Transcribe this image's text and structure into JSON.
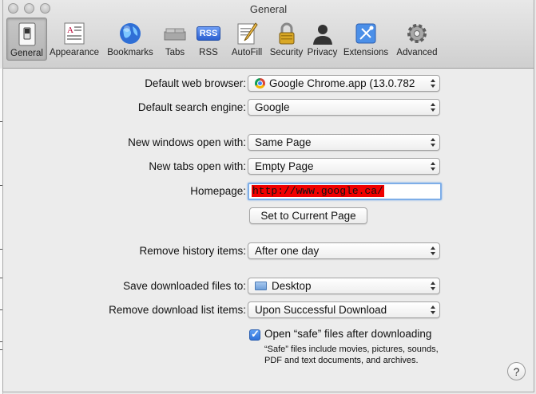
{
  "window": {
    "title": "General"
  },
  "toolbar": {
    "tabs": [
      {
        "label": "General",
        "icon": "switch-icon"
      },
      {
        "label": "Appearance",
        "icon": "appearance-icon"
      },
      {
        "label": "Bookmarks",
        "icon": "globe-icon"
      },
      {
        "label": "Tabs",
        "icon": "tabs-icon"
      },
      {
        "label": "RSS",
        "icon": "rss-icon"
      },
      {
        "label": "AutoFill",
        "icon": "autofill-icon"
      },
      {
        "label": "Security",
        "icon": "lock-icon"
      },
      {
        "label": "Privacy",
        "icon": "person-icon"
      },
      {
        "label": "Extensions",
        "icon": "extensions-icon"
      },
      {
        "label": "Advanced",
        "icon": "gear-icon"
      }
    ],
    "selected": "General",
    "rss_badge": "RSS"
  },
  "settings": {
    "default_browser": {
      "label": "Default web browser:",
      "value": "Google Chrome.app (13.0.782"
    },
    "search_engine": {
      "label": "Default search engine:",
      "value": "Google"
    },
    "new_windows": {
      "label": "New windows open with:",
      "value": "Same Page"
    },
    "new_tabs": {
      "label": "New tabs open with:",
      "value": "Empty Page"
    },
    "homepage": {
      "label": "Homepage:",
      "value": "http://www.google.ca/"
    },
    "set_current": {
      "label": "Set to Current Page"
    },
    "remove_history": {
      "label": "Remove history items:",
      "value": "After one day"
    },
    "save_downloads": {
      "label": "Save downloaded files to:",
      "value": "Desktop"
    },
    "remove_downloads": {
      "label": "Remove download list items:",
      "value": "Upon Successful Download"
    },
    "open_safe": {
      "label": "Open “safe” files after downloading",
      "checked": true,
      "note_line1": "“Safe” files include movies, pictures, sounds,",
      "note_line2": "PDF and text documents, and archives."
    }
  },
  "help": {
    "label": "?"
  },
  "colors": {
    "selection": "#f00000",
    "focus_ring": "#7eaee8",
    "checkbox": "#3a7fe0"
  }
}
